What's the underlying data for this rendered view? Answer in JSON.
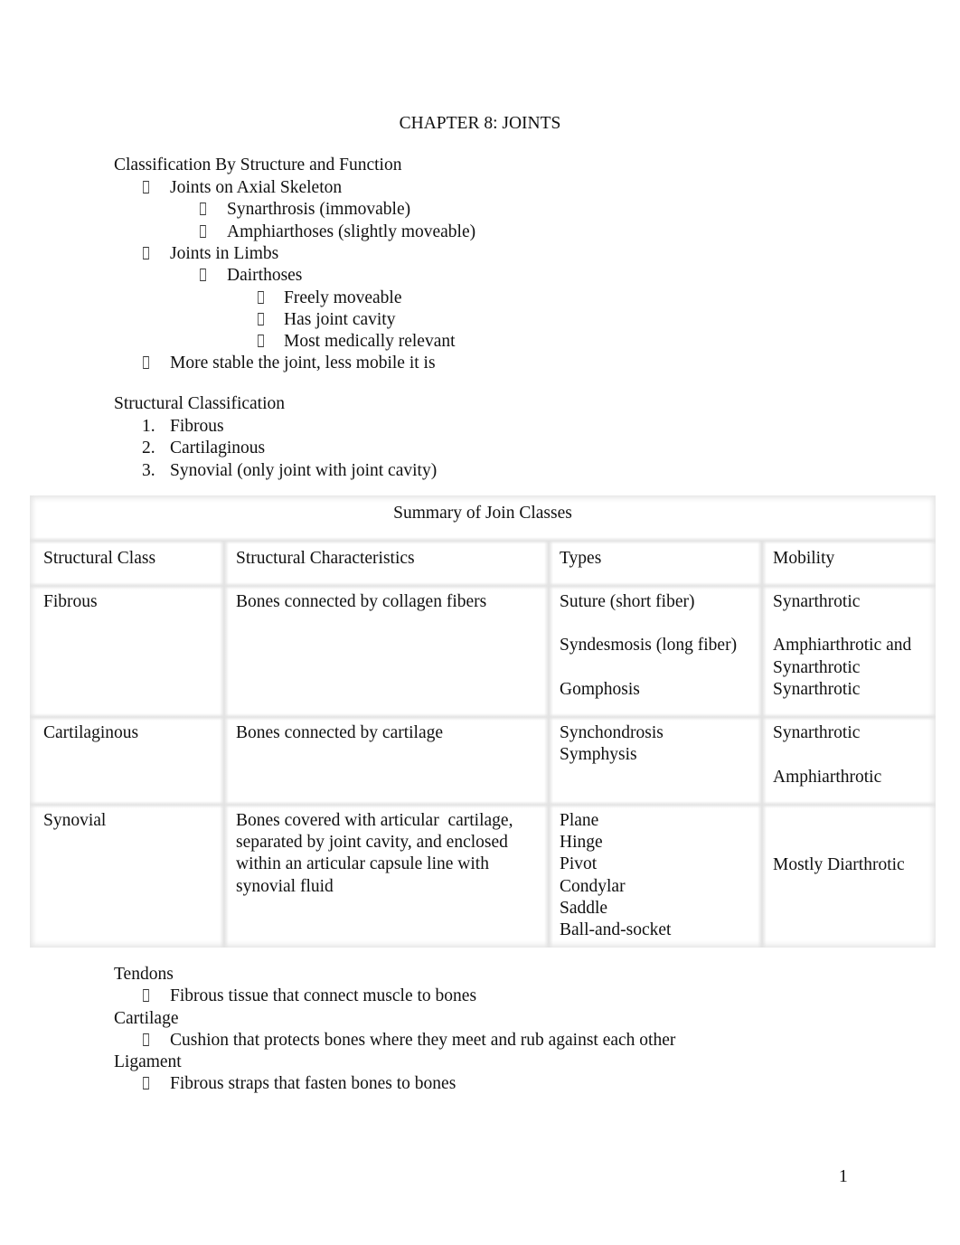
{
  "document": {
    "title": "CHAPTER 8: JOINTS",
    "page_number": "1",
    "bullet_icon": "missing-glyph-box"
  },
  "classification": {
    "heading": "Classification By Structure and Function",
    "items": [
      {
        "level": 1,
        "text": "Joints on Axial Skeleton"
      },
      {
        "level": 2,
        "text": "Synarthrosis (immovable)"
      },
      {
        "level": 2,
        "text": "Amphiarthoses (slightly moveable)"
      },
      {
        "level": 1,
        "text": "Joints in Limbs"
      },
      {
        "level": 2,
        "text": "Dairthoses"
      },
      {
        "level": 3,
        "text": "Freely moveable"
      },
      {
        "level": 3,
        "text": "Has joint cavity"
      },
      {
        "level": 3,
        "text": "Most medically relevant"
      },
      {
        "level": 1,
        "text": "More stable the joint, less mobile it is"
      }
    ]
  },
  "structural": {
    "heading": "Structural Classification",
    "items": [
      {
        "number": "1.",
        "text": "Fibrous"
      },
      {
        "number": "2.",
        "text": "Cartilaginous"
      },
      {
        "number": "3.",
        "text": "Synovial (only joint with joint cavity)"
      }
    ]
  },
  "table": {
    "caption": "Summary of Join Classes",
    "headers": [
      "Structural Class",
      "Structural Characteristics",
      "Types",
      "Mobility"
    ],
    "rows": [
      {
        "class": "Fibrous",
        "characteristics": [
          "Bones connected by collagen fibers"
        ],
        "types": [
          "Suture (short fiber)",
          "",
          "Syndesmosis (long fiber)",
          "",
          "Gomphosis"
        ],
        "mobility": [
          "Synarthrotic",
          "",
          "Amphiarthrotic and",
          "Synarthrotic",
          "Synarthrotic"
        ]
      },
      {
        "class": "Cartilaginous",
        "characteristics": [
          "Bones connected by cartilage"
        ],
        "types": [
          "Synchondrosis",
          "Symphysis"
        ],
        "mobility": [
          "Synarthrotic",
          "",
          "Amphiarthrotic"
        ]
      },
      {
        "class": "Synovial",
        "characteristics": [
          "Bones covered with articular  cartilage,",
          "separated by joint cavity, and enclosed",
          "within an articular capsule line with",
          "synovial fluid"
        ],
        "types": [
          "Plane",
          "Hinge",
          "Pivot",
          "Condylar",
          "Saddle",
          "Ball-and-socket"
        ],
        "mobility": [
          "Mostly Diarthrotic"
        ]
      }
    ]
  },
  "definitions": [
    {
      "term": "Tendons",
      "detail": "Fibrous tissue that connect muscle to bones"
    },
    {
      "term": "Cartilage",
      "detail": "Cushion that protects bones where they meet and rub against each other"
    },
    {
      "term": "Ligament",
      "detail": "Fibrous straps that fasten bones to bones"
    }
  ]
}
